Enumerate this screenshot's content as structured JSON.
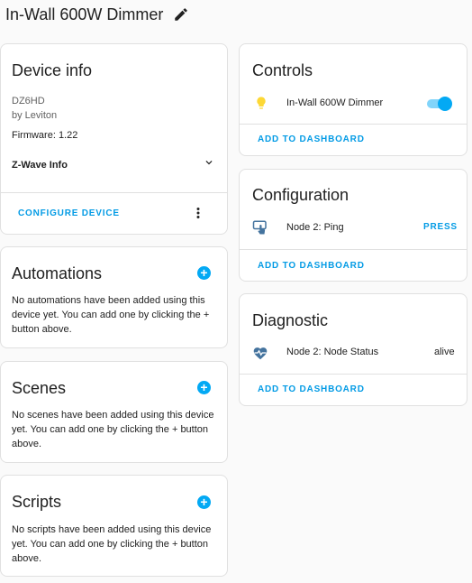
{
  "header": {
    "title": "In-Wall 600W Dimmer",
    "edit_icon": "pencil-icon"
  },
  "device_info": {
    "title": "Device info",
    "model": "DZ6HD",
    "manufacturer": "by Leviton",
    "firmware": "Firmware: 1.22",
    "zwave_info_label": "Z-Wave Info",
    "configure_label": "CONFIGURE DEVICE"
  },
  "automations": {
    "title": "Automations",
    "text": "No automations have been added using this device yet. You can add one by clicking the + button above."
  },
  "scenes": {
    "title": "Scenes",
    "text": "No scenes have been added using this device yet. You can add one by clicking the + button above."
  },
  "scripts": {
    "title": "Scripts",
    "text": "No scripts have been added using this device yet. You can add one by clicking the + button above."
  },
  "controls": {
    "title": "Controls",
    "entity_name": "In-Wall 600W Dimmer",
    "toggle_state": "on",
    "add_label": "ADD TO DASHBOARD"
  },
  "configuration": {
    "title": "Configuration",
    "entity_name": "Node 2: Ping",
    "action_label": "PRESS",
    "add_label": "ADD TO DASHBOARD"
  },
  "diagnostic": {
    "title": "Diagnostic",
    "entity_name": "Node 2: Node Status",
    "state": "alive",
    "add_label": "ADD TO DASHBOARD"
  },
  "colors": {
    "accent": "#039be5",
    "toggle": "#03a9f4",
    "bulb": "#fdd835",
    "icon": "#44739e"
  }
}
